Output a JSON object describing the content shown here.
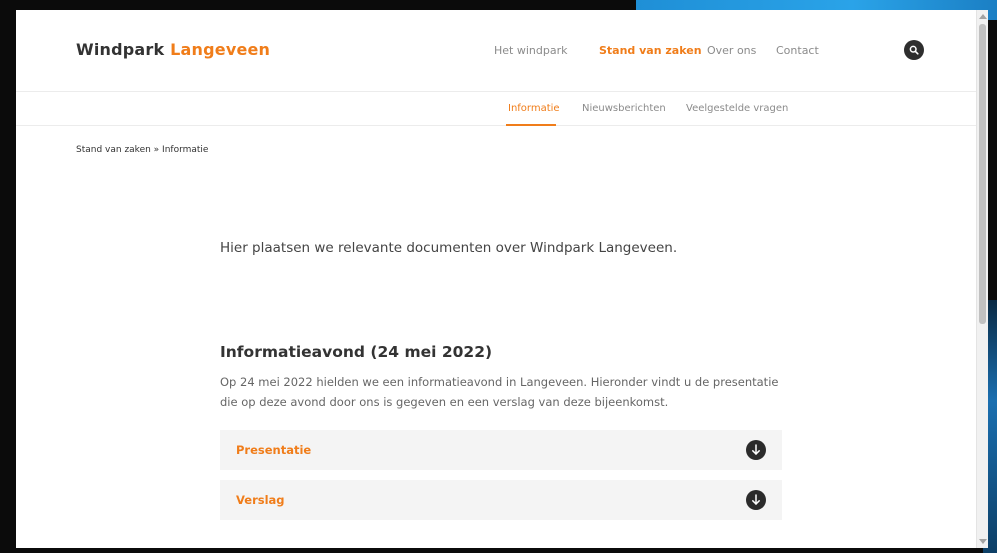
{
  "brand": {
    "name_part1": "Windpark",
    "name_part2": "Langeveen",
    "accent_color": "#f07d1a"
  },
  "nav": {
    "items": [
      {
        "label": "Het windpark",
        "active": false
      },
      {
        "label": "Stand van zaken",
        "active": true
      },
      {
        "label": "Over ons",
        "active": false
      },
      {
        "label": "Contact",
        "active": false
      }
    ],
    "search_icon": "search-icon"
  },
  "subnav": {
    "items": [
      {
        "label": "Informatie",
        "active": true
      },
      {
        "label": "Nieuwsberichten",
        "active": false
      },
      {
        "label": "Veelgestelde vragen",
        "active": false
      }
    ]
  },
  "breadcrumb": "Stand van zaken » Informatie",
  "intro": "Hier plaatsen we relevante documenten over Windpark Langeveen.",
  "section": {
    "title": "Informatieavond (24 mei 2022)",
    "text": "Op 24 mei 2022 hielden we een informatieavond in Langeveen. Hieronder vindt u de presentatie die op deze avond door ons is gegeven en een verslag van deze bijeenkomst."
  },
  "documents": [
    {
      "label": "Presentatie",
      "icon": "download-icon"
    },
    {
      "label": "Verslag",
      "icon": "download-icon"
    }
  ]
}
